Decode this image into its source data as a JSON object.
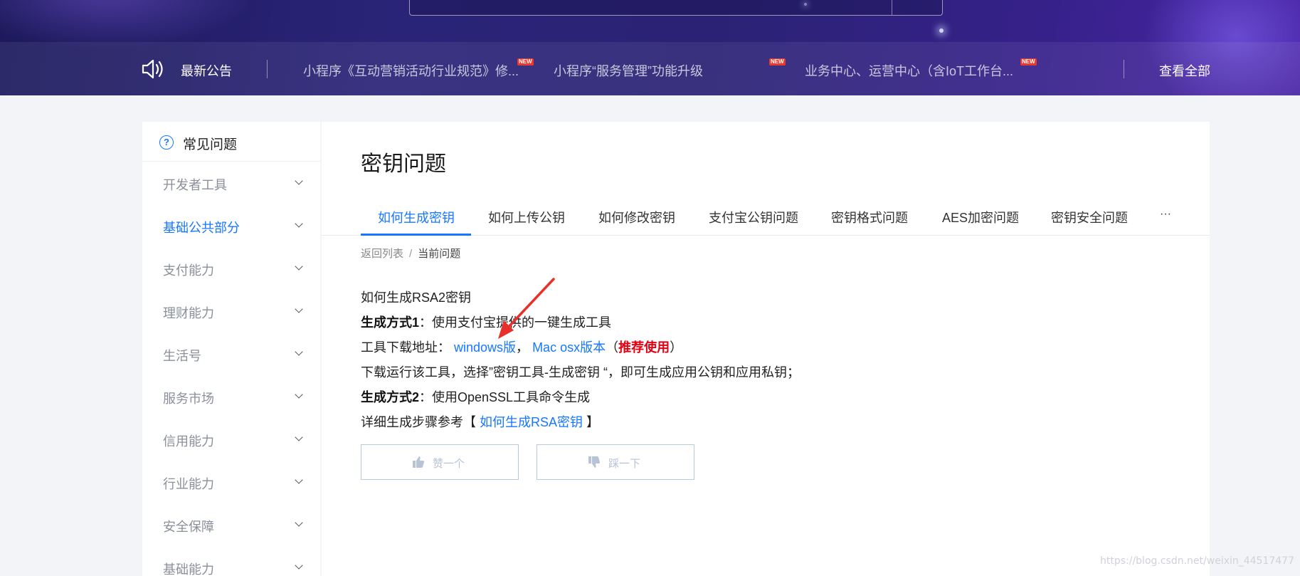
{
  "notice": {
    "title": "最新公告",
    "items": [
      "小程序《互动营销活动行业规范》修...",
      "小程序“服务管理”功能升级",
      "业务中心、运营中心（含IoT工作台..."
    ],
    "badge": "NEW",
    "view_all": "查看全部"
  },
  "sidebar": {
    "title": "常见问题",
    "items": [
      {
        "label": "开发者工具"
      },
      {
        "label": "基础公共部分"
      },
      {
        "label": "支付能力"
      },
      {
        "label": "理财能力"
      },
      {
        "label": "生活号"
      },
      {
        "label": "服务市场"
      },
      {
        "label": "信用能力"
      },
      {
        "label": "行业能力"
      },
      {
        "label": "安全保障"
      },
      {
        "label": "基础能力"
      }
    ],
    "active_index": 1
  },
  "main": {
    "title": "密钥问题",
    "tabs": [
      {
        "label": "如何生成密钥"
      },
      {
        "label": "如何上传公钥"
      },
      {
        "label": "如何修改密钥"
      },
      {
        "label": "支付宝公钥问题"
      },
      {
        "label": "密钥格式问题"
      },
      {
        "label": "AES加密问题"
      },
      {
        "label": "密钥安全问题"
      }
    ],
    "more": "···",
    "breadcrumb": {
      "back": "返回列表",
      "sep": "/",
      "current": "当前问题"
    },
    "article": {
      "heading": "如何生成RSA2密钥",
      "method1_label": "生成方式1",
      "method1_text": "：使用支付宝提供的一键生成工具",
      "download_label": "工具下载地址：",
      "windows_link": "windows版",
      "comma": "，",
      "mac_link": "Mac osx版本",
      "paren_open": "（",
      "recommend": "推荐使用",
      "paren_close": "）",
      "run_text": "下载运行该工具，选择”密钥工具-生成密钥 “，即可生成应用公钥和应用私钥；",
      "method2_label": "生成方式2",
      "method2_text": "：使用OpenSSL工具命令生成",
      "detail_prefix": "详细生成步骤参考【 ",
      "detail_link": "如何生成RSA密钥",
      "detail_suffix": " 】"
    },
    "like_label": "赞一个",
    "dislike_label": "踩一下"
  },
  "watermark": "https://blog.csdn.net/weixin_44517477",
  "colors": {
    "accent": "#1677ff",
    "header": "#2a2478",
    "highlight_red": "#e60012",
    "annotation_arrow": "#e8302a"
  }
}
